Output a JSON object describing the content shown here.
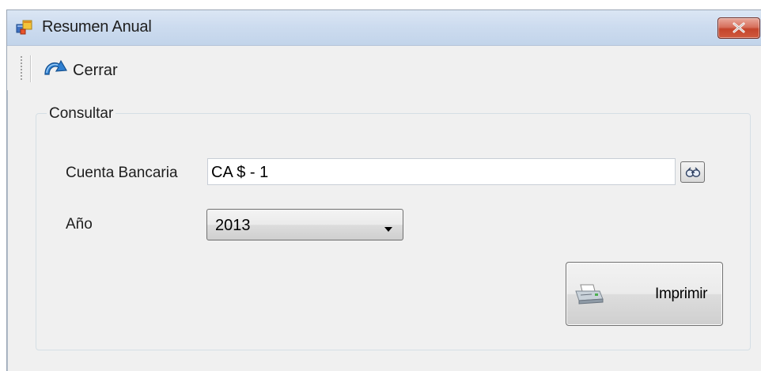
{
  "window": {
    "title": "Resumen Anual",
    "icons": {
      "app": "application-window-icon",
      "close": "close-x-icon"
    },
    "colors": {
      "titlebar": "#cddcef",
      "close_button": "#c4442b",
      "window_bg": "#f0f0f0"
    }
  },
  "toolbar": {
    "cerrar_label": "Cerrar",
    "cerrar_icon": "redo-arrow-icon"
  },
  "consultar": {
    "group_title": "Consultar",
    "cuenta_label": "Cuenta Bancaria",
    "cuenta_value": "CA $ - 1",
    "search_icon": "binoculars-icon",
    "anio_label": "Año",
    "anio_value": "2013",
    "print_label": "Imprimir",
    "print_icon": "printer-icon"
  }
}
